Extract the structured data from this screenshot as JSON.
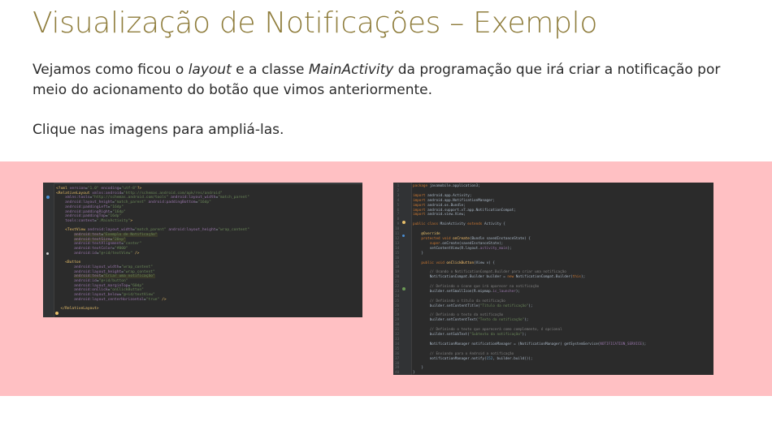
{
  "title": "Visualização de Notificações – Exemplo",
  "intro": {
    "t1": "Vejamos como ficou o ",
    "e1": "layout",
    "t2": " e a classe ",
    "e2": "MainActivity",
    "t3": " da programação que irá criar a notificação por meio do acionamento do botão que vimos anteriormente."
  },
  "hint": "Clique nas imagens para ampliá-las.",
  "images": [
    {
      "name": "layout-xml-screenshot"
    },
    {
      "name": "mainactivity-java-screenshot"
    }
  ],
  "colors": {
    "title": "#8f7d3c",
    "band": "#ffc0c3",
    "editor_bg": "#2b2b2b"
  }
}
